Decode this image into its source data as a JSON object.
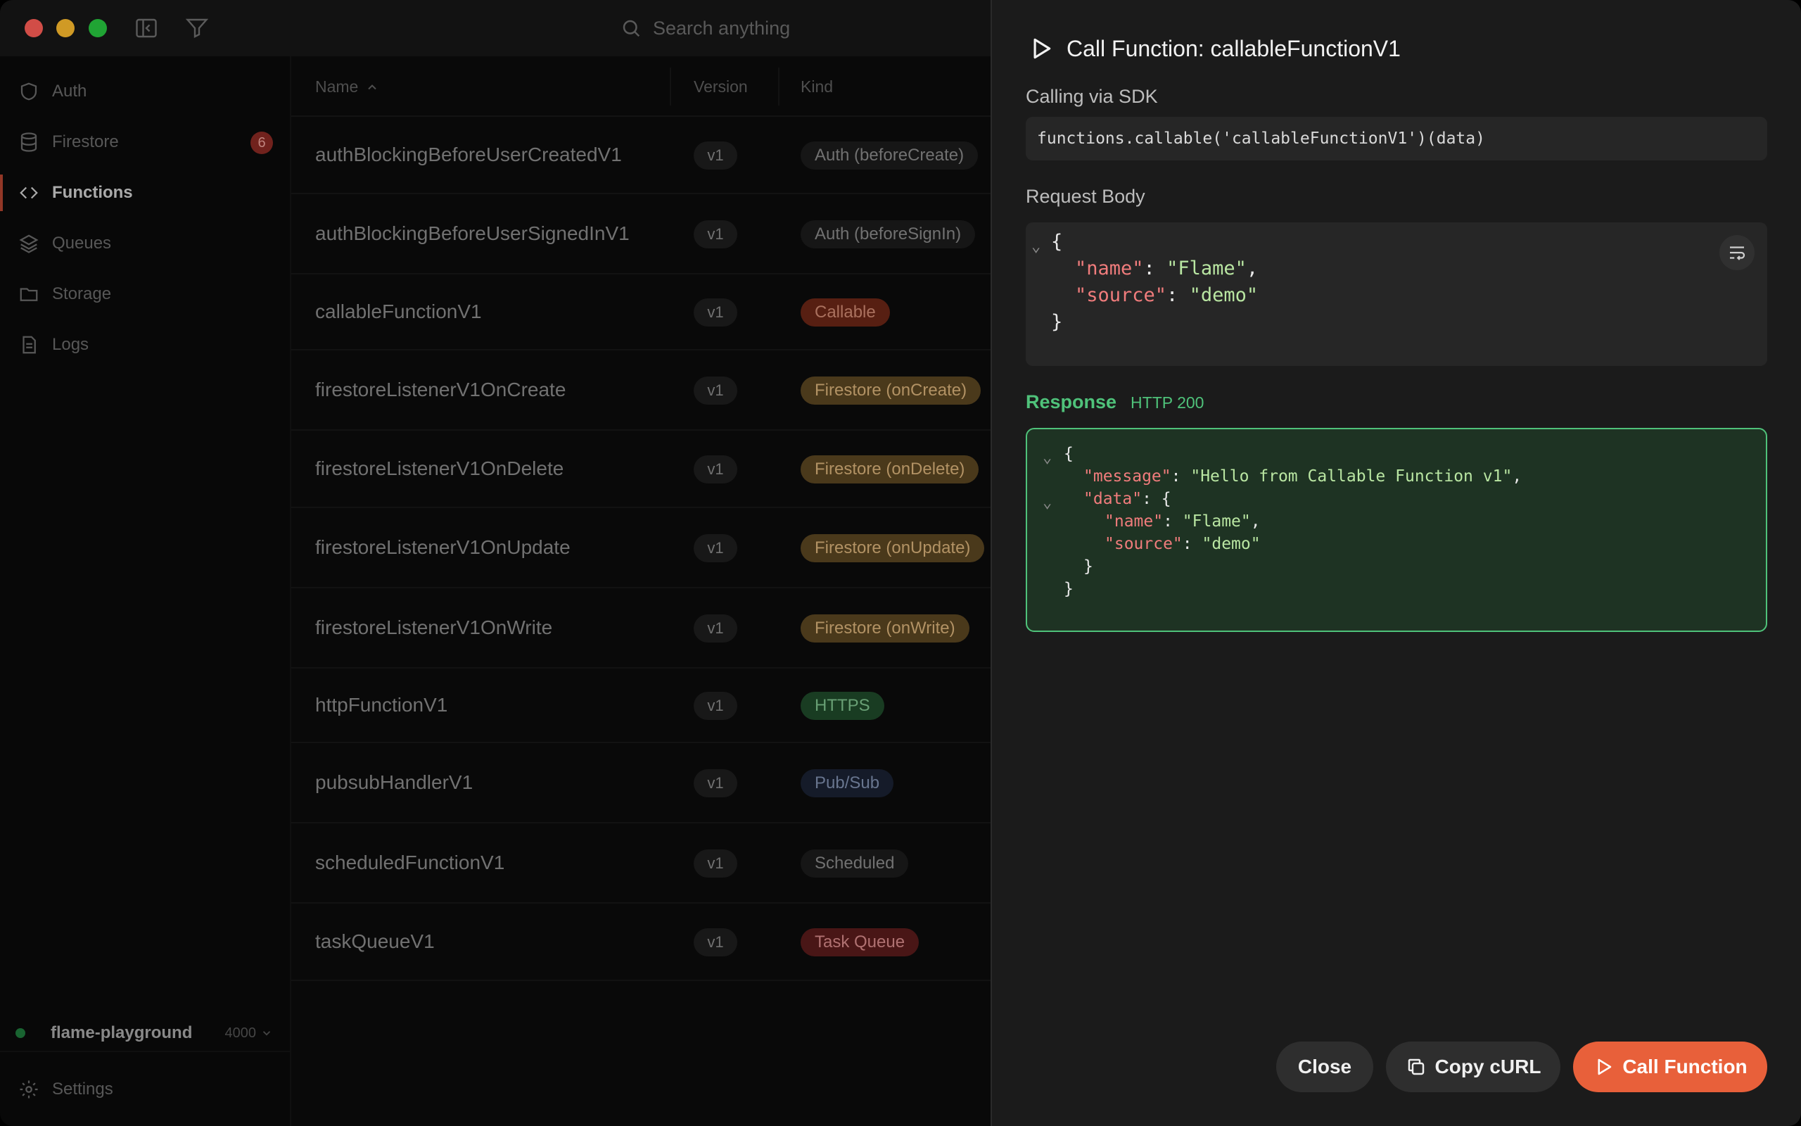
{
  "search": {
    "placeholder": "Search anything"
  },
  "sidebar": {
    "items": [
      {
        "label": "Auth",
        "icon": "shield-icon",
        "active": false
      },
      {
        "label": "Firestore",
        "icon": "database-icon",
        "active": false,
        "badge": "6"
      },
      {
        "label": "Functions",
        "icon": "code-icon",
        "active": true
      },
      {
        "label": "Queues",
        "icon": "layers-icon",
        "active": false
      },
      {
        "label": "Storage",
        "icon": "folder-icon",
        "active": false
      },
      {
        "label": "Logs",
        "icon": "document-icon",
        "active": false
      }
    ],
    "project": {
      "name": "flame-playground",
      "port": "4000",
      "status_color": "#1f7a3c"
    },
    "settings_label": "Settings"
  },
  "table": {
    "columns": {
      "name": "Name",
      "version": "Version",
      "kind": "Kind"
    },
    "rows": [
      {
        "name": "authBlockingBeforeUserCreatedV1",
        "version": "v1",
        "kind": "Auth (beforeCreate)",
        "kind_style": "neutral"
      },
      {
        "name": "authBlockingBeforeUserSignedInV1",
        "version": "v1",
        "kind": "Auth (beforeSignIn)",
        "kind_style": "neutral"
      },
      {
        "name": "callableFunctionV1",
        "version": "v1",
        "kind": "Callable",
        "kind_style": "callable"
      },
      {
        "name": "firestoreListenerV1OnCreate",
        "version": "v1",
        "kind": "Firestore (onCreate)",
        "kind_style": "firestore"
      },
      {
        "name": "firestoreListenerV1OnDelete",
        "version": "v1",
        "kind": "Firestore (onDelete)",
        "kind_style": "firestore"
      },
      {
        "name": "firestoreListenerV1OnUpdate",
        "version": "v1",
        "kind": "Firestore (onUpdate)",
        "kind_style": "firestore"
      },
      {
        "name": "firestoreListenerV1OnWrite",
        "version": "v1",
        "kind": "Firestore (onWrite)",
        "kind_style": "firestore"
      },
      {
        "name": "httpFunctionV1",
        "version": "v1",
        "kind": "HTTPS",
        "kind_style": "https"
      },
      {
        "name": "pubsubHandlerV1",
        "version": "v1",
        "kind": "Pub/Sub",
        "kind_style": "pubsub"
      },
      {
        "name": "scheduledFunctionV1",
        "version": "v1",
        "kind": "Scheduled",
        "kind_style": "neutral"
      },
      {
        "name": "taskQueueV1",
        "version": "v1",
        "kind": "Task Queue",
        "kind_style": "taskqueue"
      }
    ]
  },
  "panel": {
    "title": "Call Function: callableFunctionV1",
    "sdk_label": "Calling via SDK",
    "sdk_code": "functions.callable('callableFunctionV1')(data)",
    "request_label": "Request Body",
    "request_body": {
      "name": "Flame",
      "source": "demo"
    },
    "response_label": "Response",
    "response_status": "HTTP 200",
    "response_body": {
      "message": "Hello from Callable Function v1",
      "data": {
        "name": "Flame",
        "source": "demo"
      }
    },
    "buttons": {
      "close": "Close",
      "copy_curl": "Copy cURL",
      "call": "Call Function"
    }
  },
  "colors": {
    "accent": "#e8603a",
    "success": "#4fc27a",
    "json_key": "#f07c7c",
    "json_string": "#b9e6a2"
  }
}
